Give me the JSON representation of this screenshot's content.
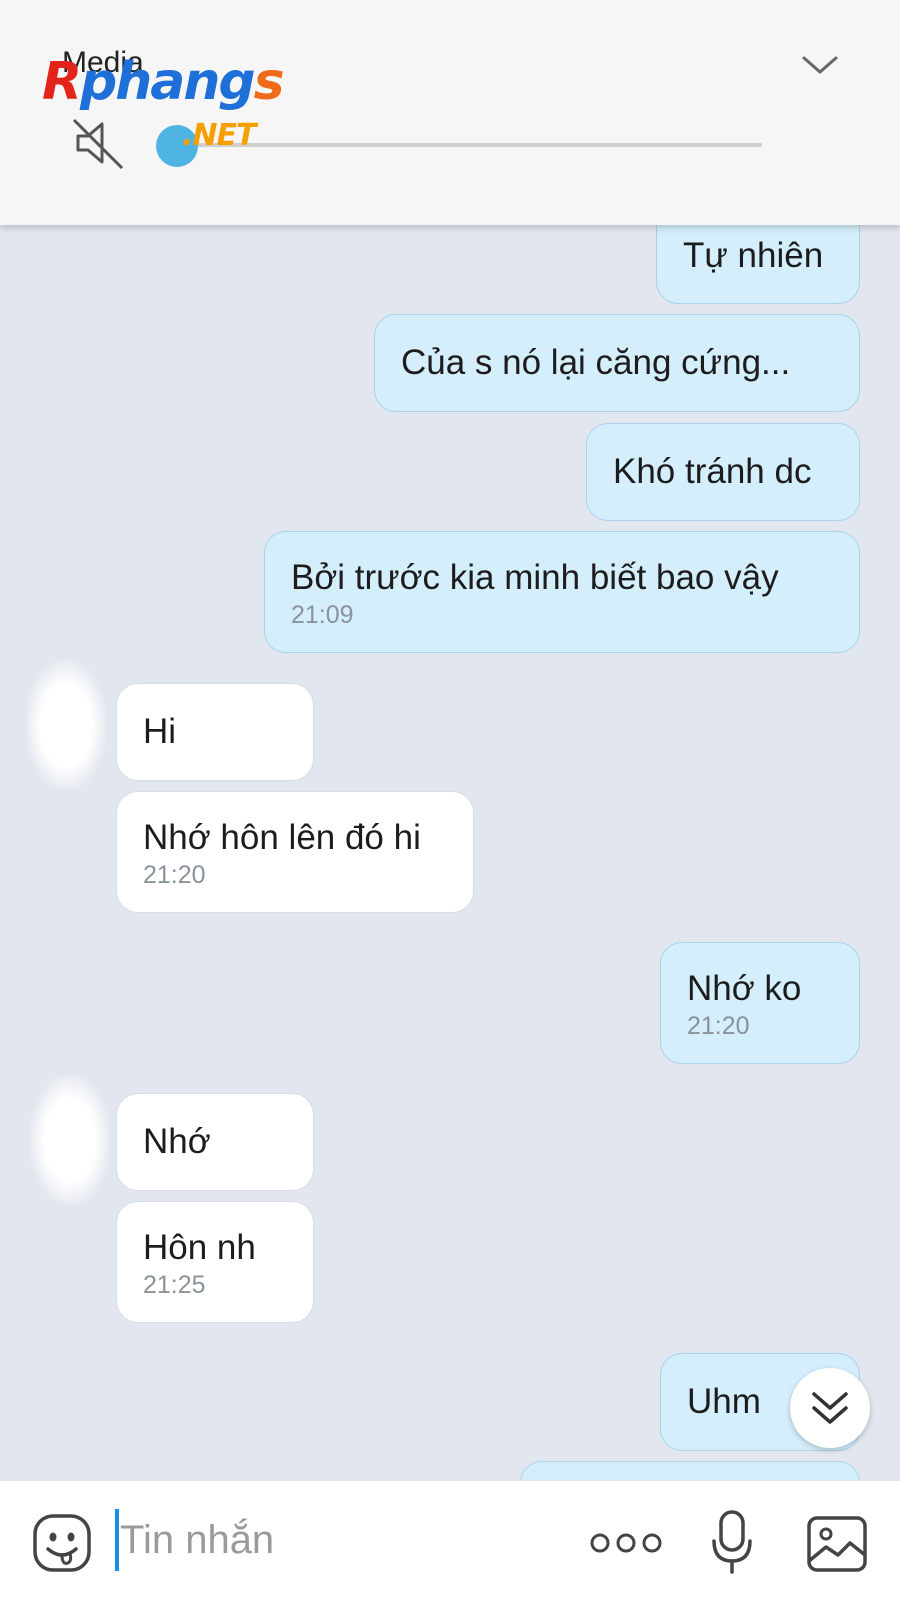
{
  "media_panel": {
    "title": "Media",
    "watermark": {
      "brand": "Rphangs",
      "brand_a": "R",
      "brand_mid": "phang",
      "brand_s": "s",
      "domain": ".NET"
    },
    "progress": 0.0
  },
  "messages": [
    {
      "direction": "out",
      "text": "Tự nhiên",
      "time": ""
    },
    {
      "direction": "out",
      "text": "Của s nó lại căng cứng...",
      "time": ""
    },
    {
      "direction": "out",
      "text": "Khó tránh dc",
      "time": ""
    },
    {
      "direction": "out",
      "text": "Bởi trước kia minh biết bao vậy",
      "time": "21:09"
    },
    {
      "direction": "in",
      "text": "Hi",
      "time": ""
    },
    {
      "direction": "in",
      "text": "Nhớ hôn lên đó hi",
      "time": "21:20"
    },
    {
      "direction": "out",
      "text": "Nhớ ko",
      "time": "21:20"
    },
    {
      "direction": "in",
      "text": "Nhớ",
      "time": ""
    },
    {
      "direction": "in",
      "text": "Hôn nh",
      "time": "21:25"
    },
    {
      "direction": "out",
      "text": "Uhm",
      "time": ""
    }
  ],
  "input_bar": {
    "placeholder": "Tin nhắn"
  },
  "colors": {
    "background": "#e2e7ef",
    "outgoing_bubble": "#d4eefc",
    "incoming_bubble": "#ffffff",
    "accent": "#4fb3e3"
  },
  "icons": {
    "mute": "speaker-muted-icon",
    "collapse": "chevron-down-icon",
    "scroll": "double-chevron-down-icon",
    "emoji": "emoji-icon",
    "more": "more-icon",
    "mic": "microphone-icon",
    "image": "image-icon"
  }
}
